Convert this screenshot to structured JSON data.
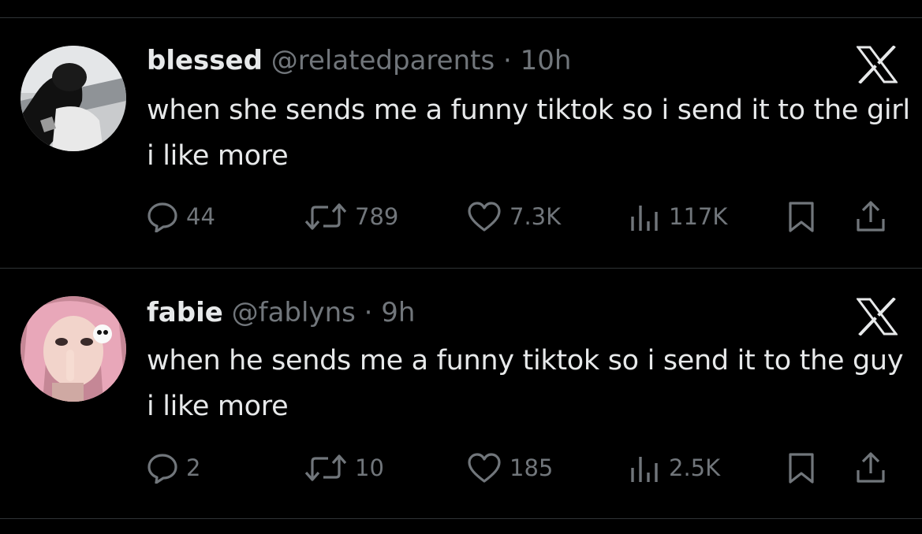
{
  "brand": {
    "background": "#000000",
    "text": "#e7e9ea",
    "secondary_text": "#71767b",
    "divider": "#2f3336"
  },
  "tweets": [
    {
      "name": "blessed",
      "handle": "@relatedparents",
      "separator": "·",
      "time": "10h",
      "text": "when she sends me a funny tiktok so i send it to the girl i like more",
      "replies": "44",
      "reposts": "789",
      "likes": "7.3K",
      "views": "117K",
      "source_icon": "x-logo-icon",
      "avatar": "grayscale-photo-avatar"
    },
    {
      "name": "fabie",
      "handle": "@fablyns",
      "separator": "·",
      "time": "9h",
      "text": "when he sends me a funny tiktok so i send it to the guy i like more",
      "replies": "2",
      "reposts": "10",
      "likes": "185",
      "views": "2.5K",
      "source_icon": "x-logo-icon",
      "avatar": "pink-hair-photo-avatar"
    }
  ]
}
